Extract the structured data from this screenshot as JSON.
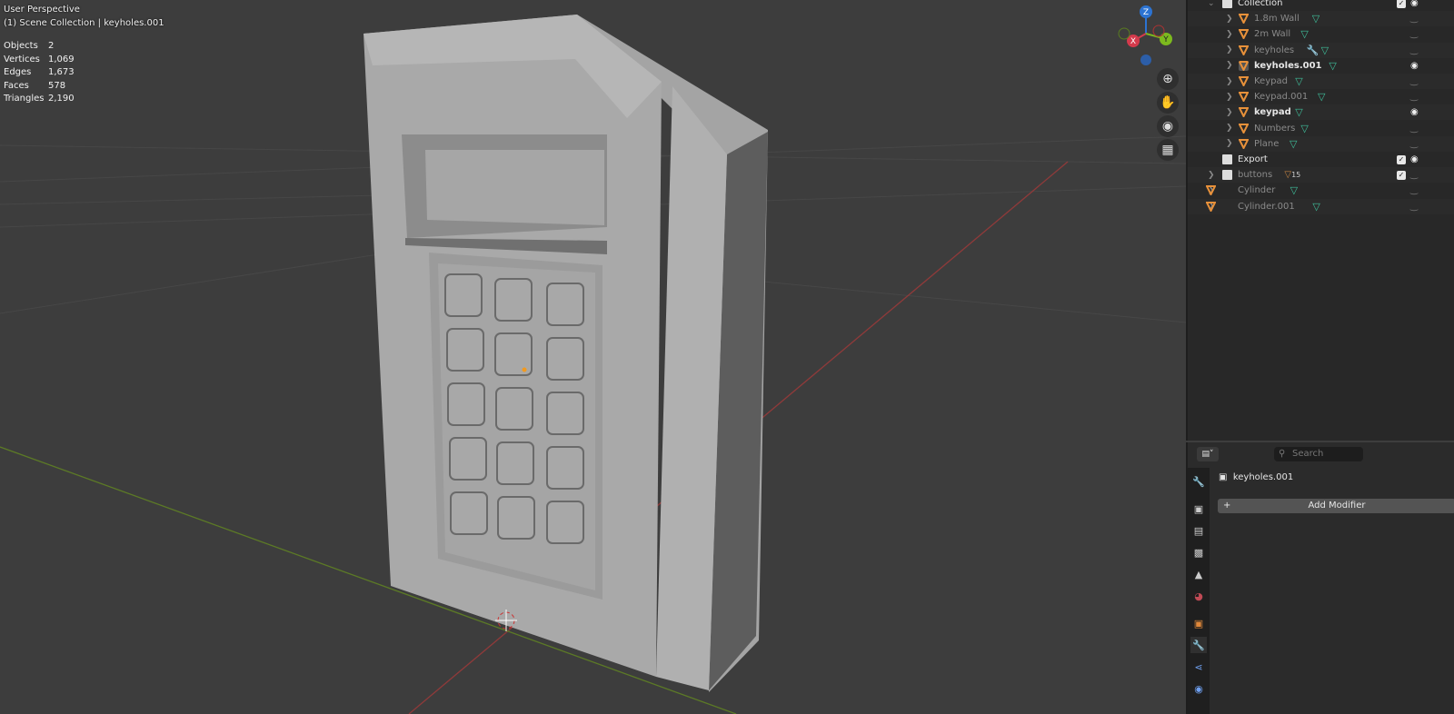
{
  "viewport": {
    "view_name": "User Perspective",
    "scene_info": "(1) Scene Collection | keyholes.001",
    "stats": [
      {
        "label": "Objects",
        "value": "2"
      },
      {
        "label": "Vertices",
        "value": "1,069"
      },
      {
        "label": "Edges",
        "value": "1,673"
      },
      {
        "label": "Faces",
        "value": "578"
      },
      {
        "label": "Triangles",
        "value": "2,190"
      }
    ],
    "gizmo": {
      "z": "Z",
      "x": "X",
      "y": "Y"
    }
  },
  "outliner": {
    "rows": [
      {
        "label": "Collection",
        "type": "collection",
        "level": 0,
        "visible": true
      },
      {
        "label": "1.8m Wall",
        "type": "mesh",
        "level": 1,
        "visible": false
      },
      {
        "label": "2m Wall",
        "type": "mesh",
        "level": 1,
        "visible": false
      },
      {
        "label": "keyholes",
        "type": "mesh",
        "level": 1,
        "visible": false,
        "modifier": true
      },
      {
        "label": "keyholes.001",
        "type": "mesh",
        "level": 1,
        "visible": true,
        "active": true
      },
      {
        "label": "Keypad",
        "type": "mesh",
        "level": 1,
        "visible": false
      },
      {
        "label": "Keypad.001",
        "type": "mesh",
        "level": 1,
        "visible": false
      },
      {
        "label": "keypad",
        "type": "mesh",
        "level": 1,
        "visible": true
      },
      {
        "label": "Numbers",
        "type": "mesh",
        "level": 1,
        "visible": false
      },
      {
        "label": "Plane",
        "type": "mesh",
        "level": 1,
        "visible": false
      },
      {
        "label": "Export",
        "type": "collection",
        "level": 0,
        "visible": true
      },
      {
        "label": "buttons",
        "type": "collection",
        "level": 0,
        "visible": false,
        "count": "15"
      },
      {
        "label": "Cylinder",
        "type": "mesh",
        "level": 0,
        "visible": false
      },
      {
        "label": "Cylinder.001",
        "type": "mesh",
        "level": 0,
        "visible": false
      }
    ]
  },
  "properties": {
    "search_placeholder": "Search",
    "object_name": "keyholes.001",
    "add_modifier": "Add Modifier"
  }
}
